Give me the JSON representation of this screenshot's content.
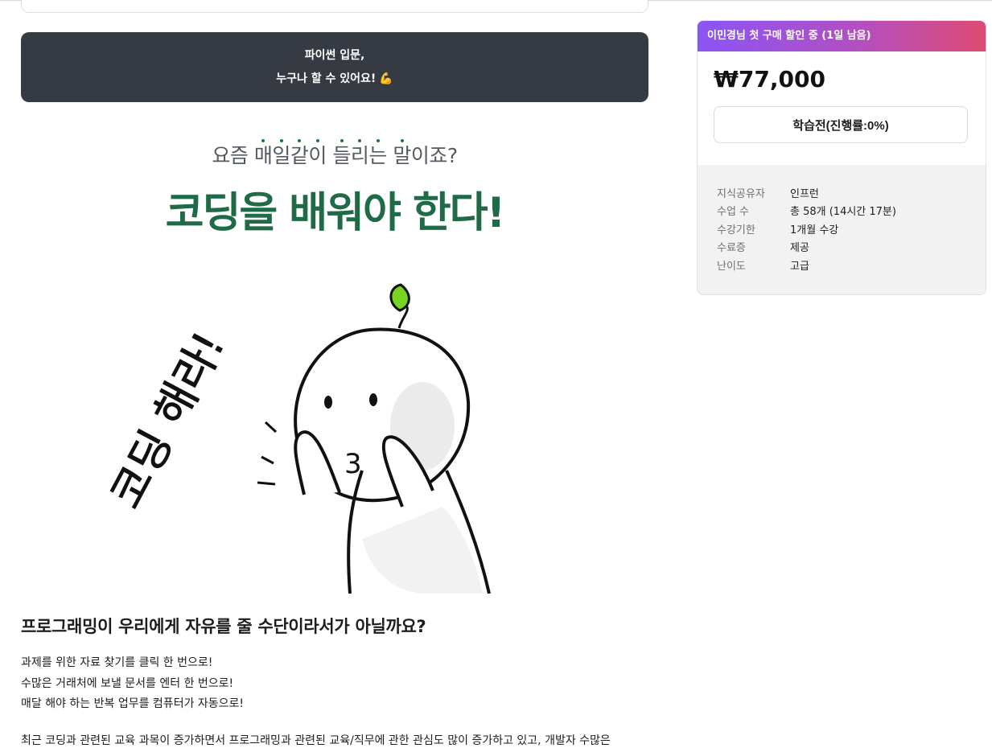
{
  "banner": {
    "line1": "파이썬 입문,",
    "line2": "누구나 할 수 있어요!",
    "emoji": "💪"
  },
  "hero": {
    "sub_pre": "요즘 ",
    "sub_em": [
      "매",
      "일",
      "같",
      "이",
      "들",
      "리",
      "는",
      "말"
    ],
    "sub_mid1": " ",
    "sub_post": "이죠?",
    "main": "코딩을 배워야 한다!"
  },
  "illustration": {
    "handwriting": "코딩 해라!",
    "face_mark": "3"
  },
  "content": {
    "section_title": "프로그래밍이 우리에게 자유를 줄 수단이라서가 아닐까요?",
    "lines": [
      "과제를 위한 자료 찾기를 클릭 한 번으로!",
      "수많은 거래처에 보낼 문서를 엔터 한 번으로!",
      "매달 해야 하는 반복 업무를 컴퓨터가 자동으로!"
    ],
    "cut_line": "최근 코딩과 관련된 교육 과목이 증가하면서 프로그래밍과 관련된 교육/직무에 관한 관심도 많이 증가하고 있고, 개발자 수많은"
  },
  "sidebar": {
    "promo": "이민경님 첫 구매 할인 중 (1일 남음)",
    "price": "₩77,000",
    "status_button": "학습전(진행률:0%)",
    "info": [
      {
        "key": "지식공유자",
        "value": "인프런"
      },
      {
        "key": "수업 수",
        "value": "총 58개 (14시간 17분)"
      },
      {
        "key": "수강기한",
        "value": "1개월 수강"
      },
      {
        "key": "수료증",
        "value": "제공"
      },
      {
        "key": "난이도",
        "value": "고급"
      }
    ]
  },
  "colors": {
    "banner_bg": "#363a42",
    "hero_green": "#1f6b46",
    "promo_gradient": [
      "#8b55f5",
      "#dd4a72"
    ],
    "info_bg": "#f2f2f2",
    "sprout": "#7bd321"
  }
}
